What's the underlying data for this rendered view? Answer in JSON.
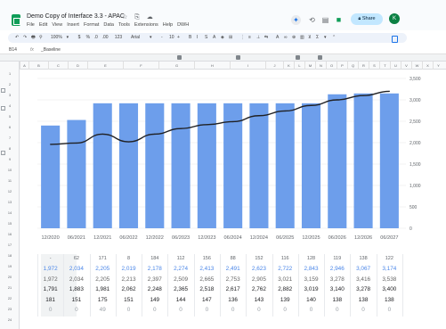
{
  "app": {
    "title": "Demo Copy of Interface 3.3 - APAC",
    "title_icons": "☆ ⎘ ☁",
    "menu": [
      "File",
      "Edit",
      "View",
      "Insert",
      "Format",
      "Data",
      "Tools",
      "Extensions",
      "Help",
      "DWH"
    ],
    "share_label": "Share",
    "avatar_initial": "K",
    "colors": {
      "brand": "#0f9d58",
      "share_bg": "#c2e7ff",
      "accent": "#1a73e8"
    }
  },
  "toolbar": {
    "items": [
      "↶",
      "↷",
      "🖶",
      "⚲",
      "100%",
      "▾",
      "$",
      "%",
      ".0",
      ".00",
      "123",
      "Arial",
      "▾",
      "-",
      "10",
      "+",
      "B",
      "I",
      "S",
      "A",
      "◈",
      "⊞",
      "⋮",
      "≡",
      "⊥",
      "⇆",
      "A",
      "∞",
      "⊕",
      "▥",
      "⊻",
      "Σ",
      "▾",
      "⌃"
    ]
  },
  "formula_bar": {
    "cell_ref": "B14",
    "fx": "fx",
    "content": "_Baseline"
  },
  "grid": {
    "row_numbers": [
      "1",
      "2",
      "3",
      "4",
      "5",
      "6",
      "7",
      "8",
      "9",
      "10",
      "11",
      "12",
      "13",
      "14",
      "15",
      "16",
      "17",
      "18",
      "19",
      "20",
      "21",
      "22",
      "23",
      "24"
    ],
    "column_headers": [
      "A",
      "B",
      "C",
      "D",
      "E",
      "F",
      "G",
      "H",
      "I",
      "J",
      "K",
      "L",
      "M",
      "N",
      "O",
      "P",
      "Q",
      "R",
      "S",
      "T",
      "U",
      "V",
      "W",
      "X",
      "Y",
      "Z",
      "AA",
      "AB",
      "AC"
    ]
  },
  "chart_data": {
    "type": "bar",
    "categories": [
      "12/2020",
      "06/2021",
      "12/2021",
      "06/2022",
      "12/2022",
      "06/2023",
      "12/2023",
      "06/2024",
      "12/2024",
      "06/2025",
      "12/2025",
      "06/2026",
      "12/2026",
      "06/2027"
    ],
    "series": [
      {
        "type": "bar",
        "values": [
          2400,
          2530,
          2920,
          2920,
          2920,
          2920,
          2920,
          2920,
          2920,
          2920,
          2920,
          3130,
          3150,
          3150
        ],
        "color": "#6d9eeb"
      },
      {
        "type": "line",
        "values": [
          1960,
          1990,
          2200,
          2020,
          2200,
          2330,
          2420,
          2490,
          2630,
          2740,
          2870,
          3000,
          3100,
          3200
        ],
        "color": "#202124"
      }
    ],
    "yaxis_ticks": [
      "3,500",
      "3,000",
      "2,500",
      "2,000",
      "1,500",
      "1,000",
      "500",
      "0"
    ],
    "ylim": [
      0,
      3500
    ],
    "grid": true,
    "legend": "none",
    "title": "",
    "xlabel": "",
    "ylabel": ""
  },
  "table": {
    "rows": [
      {
        "style": "hdr",
        "cells": [
          "-",
          "62",
          "171",
          "8",
          "184",
          "112",
          "156",
          "88",
          "152",
          "116",
          "128",
          "119",
          "138",
          "122"
        ]
      },
      {
        "style": "blue",
        "cells": [
          "1,972",
          "2,034",
          "2,205",
          "2,019",
          "2,178",
          "2,274",
          "2,413",
          "2,491",
          "2,623",
          "2,722",
          "2,843",
          "2,946",
          "3,067",
          "3,174"
        ]
      },
      {
        "style": "gray",
        "cells": [
          "1,972",
          "2,034",
          "2,205",
          "2,213",
          "2,397",
          "2,509",
          "2,665",
          "2,753",
          "2,905",
          "3,021",
          "3,159",
          "3,278",
          "3,416",
          "3,538"
        ]
      },
      {
        "style": "dark",
        "cells": [
          "1,791",
          "1,883",
          "1,981",
          "2,062",
          "2,248",
          "2,365",
          "2,518",
          "2,617",
          "2,762",
          "2,882",
          "3,019",
          "3,140",
          "3,278",
          "3,400"
        ]
      },
      {
        "style": "dark",
        "cells": [
          "181",
          "151",
          "175",
          "151",
          "149",
          "144",
          "147",
          "136",
          "143",
          "139",
          "140",
          "138",
          "138",
          "138"
        ]
      },
      {
        "style": "muted",
        "cells": [
          "0",
          "0",
          "49",
          "0",
          "0",
          "0",
          "0",
          "0",
          "0",
          "0",
          "0",
          "0",
          "0",
          "0"
        ]
      }
    ]
  }
}
